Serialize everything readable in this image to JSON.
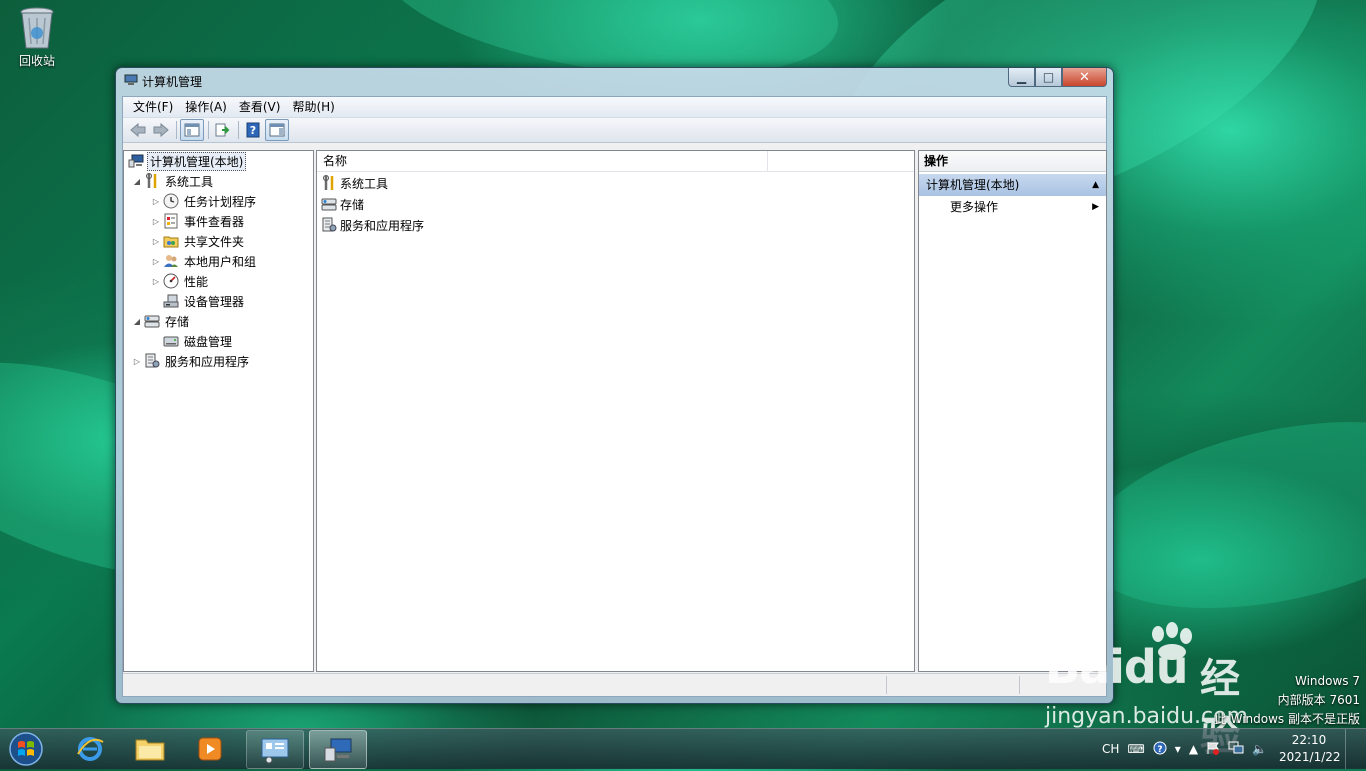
{
  "desktop": {
    "recycle_bin_label": "回收站"
  },
  "window": {
    "title": "计算机管理",
    "menu": [
      "文件(F)",
      "操作(A)",
      "查看(V)",
      "帮助(H)"
    ],
    "toolbar_icons": [
      "back-icon",
      "forward-icon",
      "show-tree-icon",
      "export-icon",
      "help-icon",
      "show-action-pane-icon"
    ]
  },
  "tree": {
    "root": "计算机管理(本地)",
    "system_tools": "系统工具",
    "task_scheduler": "任务计划程序",
    "event_viewer": "事件查看器",
    "shared_folders": "共享文件夹",
    "local_users": "本地用户和组",
    "performance": "性能",
    "device_manager": "设备管理器",
    "storage": "存储",
    "disk_management": "磁盘管理",
    "services_apps": "服务和应用程序"
  },
  "list": {
    "column_name": "名称",
    "rows": [
      "系统工具",
      "存储",
      "服务和应用程序"
    ]
  },
  "actions": {
    "header": "操作",
    "section": "计算机管理(本地)",
    "more": "更多操作"
  },
  "watermark": {
    "brand_left": "Bai",
    "brand_right": "du",
    "jingyan": "经验",
    "url": "jingyan.baidu.com"
  },
  "windows_info": {
    "line1": "Windows 7",
    "line2": "内部版本 7601",
    "line3": "此 Windows 副本不是正版"
  },
  "tray": {
    "lang": "CH",
    "time": "22:10",
    "date": "2021/1/22"
  },
  "colors": {
    "selection_blue": "#a9c3e3",
    "close_red": "#c8452c"
  }
}
